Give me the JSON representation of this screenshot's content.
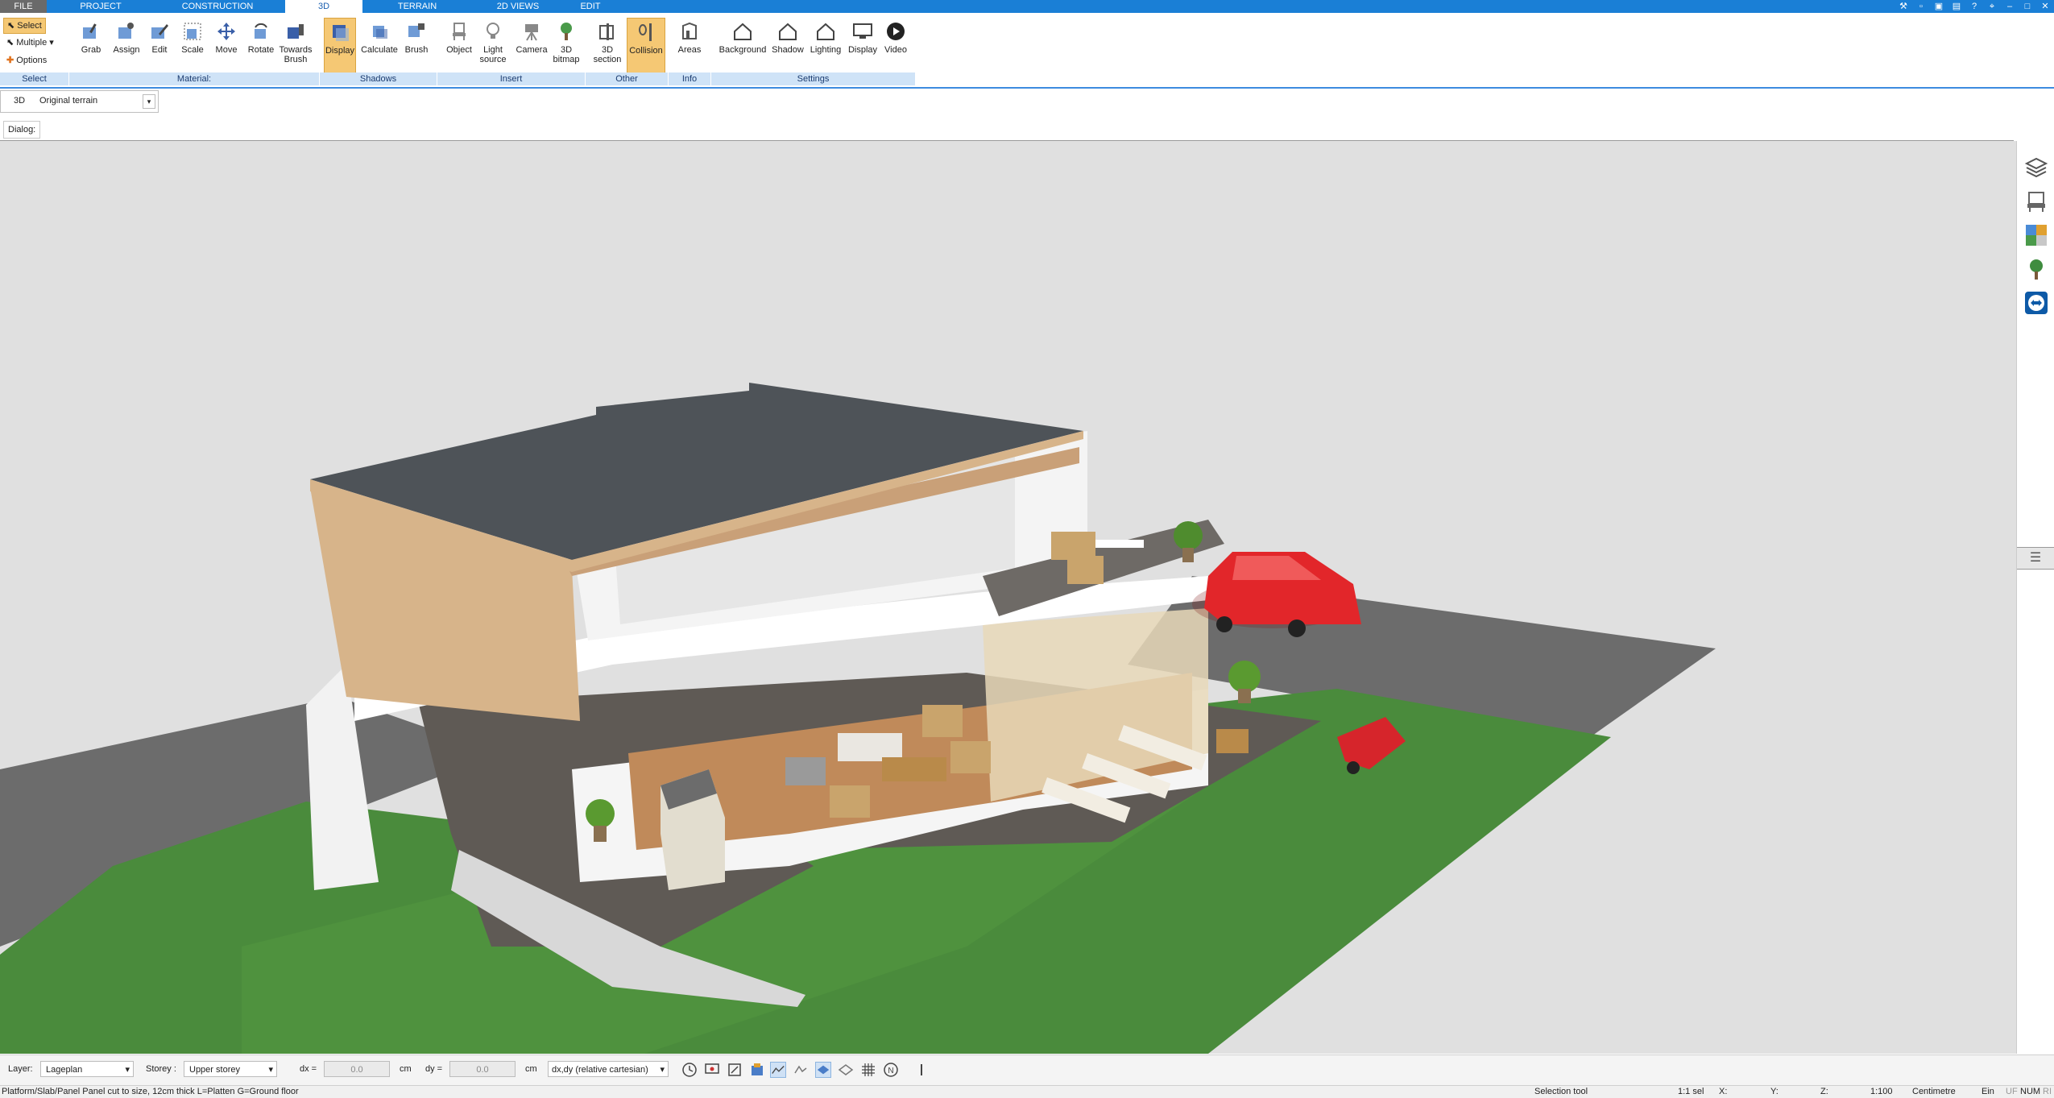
{
  "menu": {
    "tabs": [
      "FILE",
      "PROJECT",
      "CONSTRUCTION",
      "3D",
      "TERRAIN",
      "2D VIEWS",
      "EDIT"
    ],
    "active_tab": "3D"
  },
  "ribbon": {
    "select_group": {
      "select": "Select",
      "multiple": "Multiple",
      "options": "Options",
      "label": "Select"
    },
    "material_group": {
      "buttons": [
        "Grab",
        "Assign",
        "Edit",
        "Scale",
        "Move",
        "Rotate",
        "Towards Brush"
      ],
      "label": "Material:"
    },
    "shadows_group": {
      "buttons": [
        "Display",
        "Calculate",
        "Brush"
      ],
      "label": "Shadows"
    },
    "insert_group": {
      "buttons": [
        "Object",
        "Light source",
        "Camera",
        "3D bitmap"
      ],
      "label": "Insert"
    },
    "other_group": {
      "buttons": [
        "3D section",
        "Collision"
      ],
      "label": "Other"
    },
    "info_group": {
      "buttons": [
        "Areas"
      ],
      "label": "Info"
    },
    "settings_group": {
      "buttons": [
        "Background",
        "Shadow",
        "Lighting",
        "Display",
        "Video"
      ],
      "label": "Settings"
    }
  },
  "view_selector": {
    "mode": "3D",
    "value": "Original terrain"
  },
  "dialog_label": "Dialog:",
  "bottom": {
    "layer_label": "Layer:",
    "layer_value": "Lageplan",
    "storey_label": "Storey :",
    "storey_value": "Upper storey",
    "dx_label": "dx =",
    "dx_value": "0.0",
    "dx_unit": "cm",
    "dy_label": "dy =",
    "dy_value": "0.0",
    "dy_unit": "cm",
    "coord_mode": "dx,dy (relative cartesian)"
  },
  "status": {
    "message": "Platform/Slab/Panel Panel cut to size, 12cm thick L=Platten G=Ground floor",
    "tool": "Selection tool",
    "selection": "1:1 sel",
    "x": "X:",
    "y": "Y:",
    "z": "Z:",
    "scale": "1:100",
    "unit": "Centimetre",
    "ein": "Ein",
    "uf": "UF",
    "num": "NUM",
    "ri": "RI"
  },
  "colors": {
    "menu_bar": "#1a7fd6",
    "ribbon_group_label": "#cfe3f7",
    "active_button": "#f5c874",
    "viewport_bg": "#e0e0e0",
    "grass": "#4a8b3c",
    "road": "#6c6c6c",
    "car": "#e2262a"
  }
}
